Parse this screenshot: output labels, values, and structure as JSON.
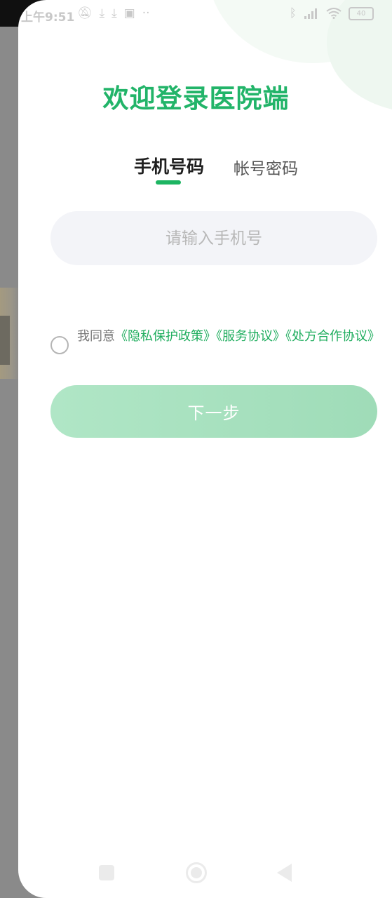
{
  "status_bar": {
    "time": "上午9:51",
    "battery": "40"
  },
  "login": {
    "title": "欢迎登录医院端",
    "tabs": [
      {
        "label": "手机号码",
        "active": true
      },
      {
        "label": "帐号密码",
        "active": false
      }
    ],
    "phone_placeholder": "请输入手机号",
    "phone_value": "",
    "agreement_prefix": "我同意",
    "agreement_links": [
      "《隐私保护政策》",
      "《服务协议》",
      "《处方合作协议》"
    ],
    "agree_checked": false,
    "next_label": "下一步"
  },
  "colors": {
    "brand": "#22b469",
    "link": "#1fad5e",
    "button": "#a8e1c0",
    "input_bg": "#f3f4f8"
  },
  "icons": {
    "status_left": [
      "mute-icon",
      "download-icon",
      "download-icon",
      "app-icon",
      "more-icon"
    ],
    "status_right": [
      "bluetooth-icon",
      "signal-icon",
      "wifi-icon",
      "battery-icon"
    ],
    "nav": [
      "recent-apps-icon",
      "home-icon",
      "back-icon"
    ]
  }
}
